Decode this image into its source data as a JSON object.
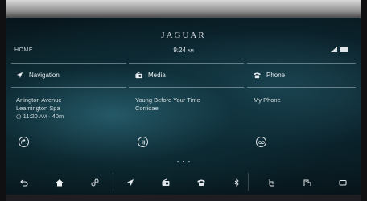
{
  "brand": "JAGUAR",
  "status_bar": {
    "home": "HOME",
    "time": "9:24",
    "ampm": "AM"
  },
  "tiles": [
    {
      "title": "Navigation",
      "icon": "navigation-arrow-icon",
      "lines": [
        "Arlington Avenue",
        "Leamington Spa"
      ],
      "eta": "11:20",
      "eta_ampm": "AM",
      "duration": "40m",
      "button": "go-icon"
    },
    {
      "title": "Media",
      "icon": "radio-icon",
      "lines": [
        "Young Before Your Time",
        "Corridae"
      ],
      "button": "pause-icon"
    },
    {
      "title": "Phone",
      "icon": "phone-icon",
      "lines": [
        "My Phone"
      ],
      "button": "voicemail-icon"
    }
  ],
  "page_indicator": {
    "pages": 3,
    "active": 1
  },
  "bottom_bar": [
    "back-icon",
    "home-icon",
    "link-icon",
    "navigation-icon",
    "media-icon",
    "phone-icon",
    "bluetooth-icon",
    "climate-icon",
    "vehicle-icon",
    "camera-icon"
  ]
}
